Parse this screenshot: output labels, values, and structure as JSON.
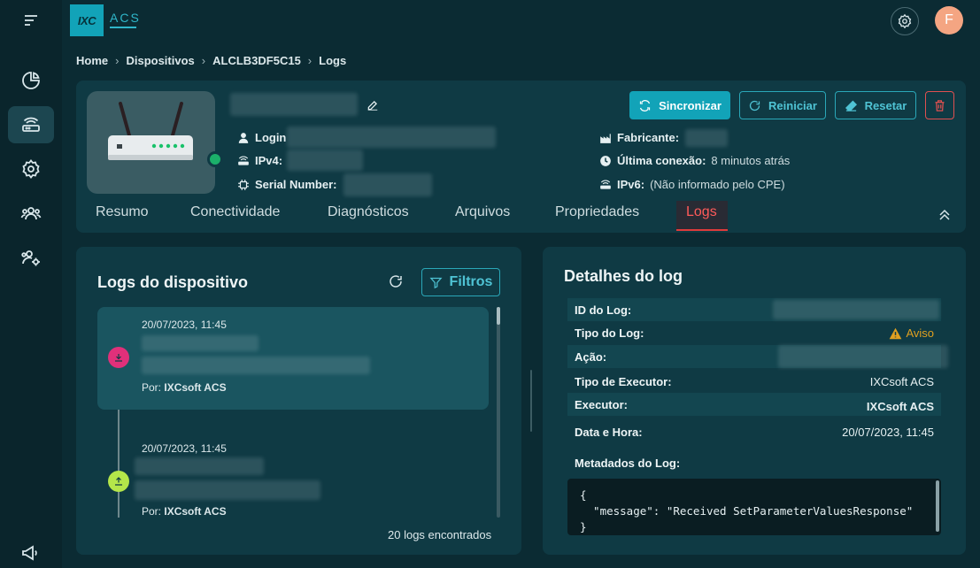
{
  "topbar": {
    "logo_text": "IXC",
    "product_name": "ACS",
    "avatar_initial": "F"
  },
  "sidebar": {
    "items": [
      {
        "name": "menu-icon"
      },
      {
        "name": "dashboard-icon"
      },
      {
        "name": "devices-icon",
        "active": true
      },
      {
        "name": "settings-icon"
      },
      {
        "name": "users-icon"
      },
      {
        "name": "user-settings-icon"
      },
      {
        "name": "announcements-icon"
      }
    ]
  },
  "breadcrumb": {
    "items": [
      "Home",
      "Dispositivos",
      "ALCLB3DF5C15",
      "Logs"
    ],
    "separator": "›"
  },
  "device": {
    "labels": {
      "login": "Login",
      "ipv4": "IPv4:",
      "serial": "Serial Number:",
      "manufacturer": "Fabricante:",
      "last_connection": "Última conexão:",
      "ipv6": "IPv6:"
    },
    "values": {
      "last_connection": "8 minutos atrás",
      "ipv6": "(Não informado pelo CPE)"
    },
    "status_color": "#1bb06a",
    "actions": {
      "sync": "Sincronizar",
      "restart": "Reiniciar",
      "reset": "Resetar"
    },
    "tabs": [
      {
        "label": "Resumo"
      },
      {
        "label": "Conectividade"
      },
      {
        "label": "Diagnósticos"
      },
      {
        "label": "Arquivos"
      },
      {
        "label": "Propriedades"
      },
      {
        "label": "Logs",
        "active": true
      }
    ]
  },
  "logs_panel": {
    "title": "Logs do dispositivo",
    "filter_label": "Filtros",
    "entries": [
      {
        "time": "20/07/2023, 11:45",
        "by_label": "Por:",
        "by_value": "IXCsoft ACS",
        "direction": "download",
        "color": "#e0307a",
        "selected": true
      },
      {
        "time": "20/07/2023, 11:45",
        "by_label": "Por:",
        "by_value": "IXCsoft ACS",
        "direction": "upload",
        "color": "#b4e64a",
        "selected": false
      }
    ],
    "count_text": "20 logs encontrados"
  },
  "details_panel": {
    "title": "Detalhes do log",
    "rows": [
      {
        "label": "ID do Log:",
        "value": ""
      },
      {
        "label": "Tipo do Log:",
        "value": "Aviso"
      },
      {
        "label": "Ação:",
        "value": ""
      },
      {
        "label": "Tipo de Executor:",
        "value": "IXCsoft ACS"
      },
      {
        "label": "Executor:",
        "value": "IXCsoft ACS"
      },
      {
        "label": "Data e Hora:",
        "value": "20/07/2023, 11:45"
      }
    ],
    "metadata_label": "Metadados do Log:",
    "metadata_code": "{\n  \"message\": \"Received SetParameterValuesResponse\"\n}",
    "warning_color": "#e0a020"
  }
}
